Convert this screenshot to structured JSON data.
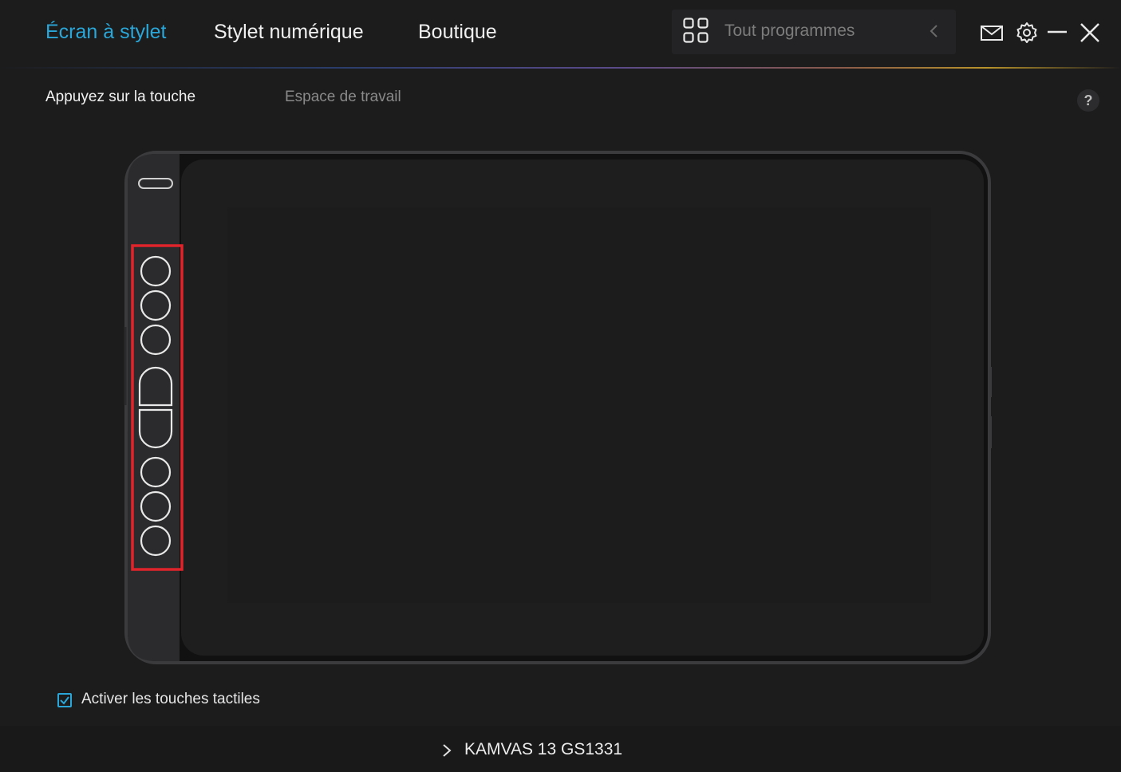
{
  "nav": {
    "tabs": [
      {
        "label": "Écran à stylet",
        "active": true
      },
      {
        "label": "Stylet numérique",
        "active": false
      },
      {
        "label": "Boutique",
        "active": false
      }
    ],
    "programs_label": "Tout programmes",
    "accent_color": "#2aa7d8"
  },
  "window_controls": {
    "icons": [
      "mail-icon",
      "settings-icon",
      "minimize-icon",
      "close-icon"
    ]
  },
  "subtabs": [
    {
      "label": "Appuyez sur la touche",
      "active": true
    },
    {
      "label": "Espace de travail",
      "active": false
    }
  ],
  "help_label": "?",
  "tablet": {
    "express_keys": [
      "key-1",
      "key-2",
      "key-3",
      "key-4-up",
      "key-5-down",
      "key-6",
      "key-7",
      "key-8"
    ],
    "highlight_color": "#e0242b"
  },
  "options": {
    "enable_touch_label": "Activer les touches tactiles",
    "enable_touch_checked": true
  },
  "footer": {
    "device_name": "KAMVAS 13 GS1331"
  }
}
